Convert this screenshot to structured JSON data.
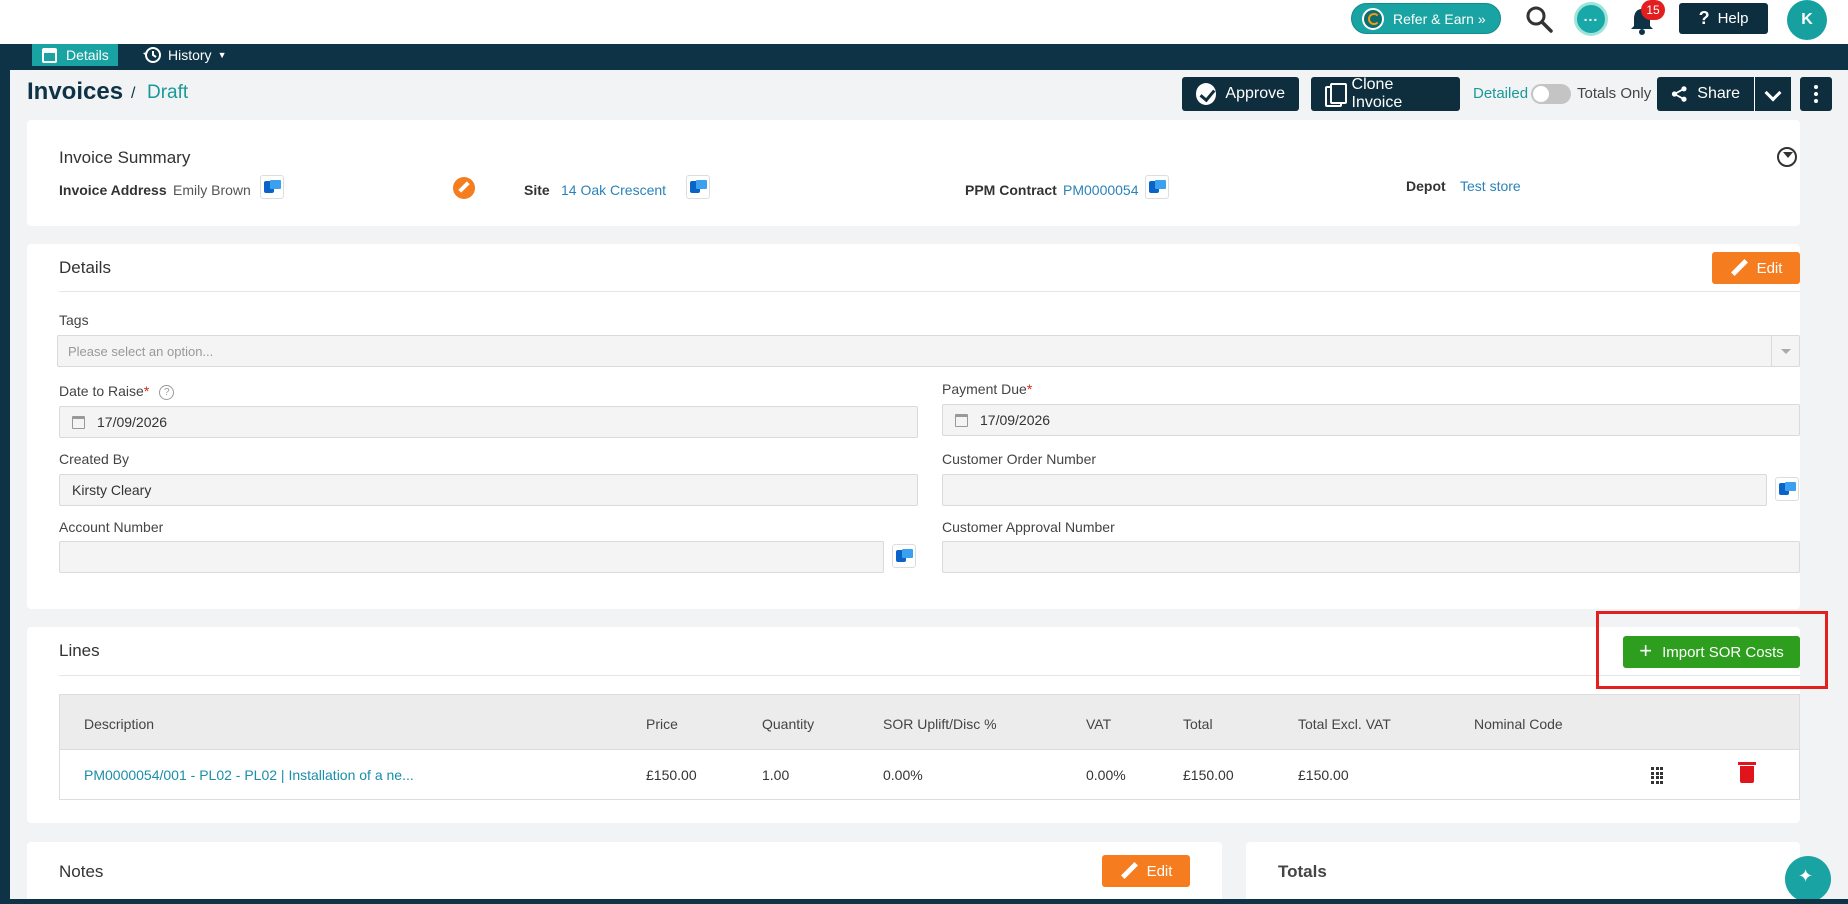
{
  "topbar": {
    "refer_label": "Refer & Earn »",
    "notification_count": "15",
    "help_label": "Help",
    "avatar_initial": "K"
  },
  "tabs": {
    "details": "Details",
    "history": "History"
  },
  "header": {
    "title": "Invoices",
    "separator": "/",
    "status": "Draft",
    "approve_label": "Approve",
    "clone_label": "Clone Invoice",
    "toggle_left": "Detailed",
    "toggle_right": "Totals Only",
    "share_label": "Share"
  },
  "summary": {
    "title": "Invoice Summary",
    "address_label": "Invoice Address",
    "address_value": "Emily Brown",
    "site_label": "Site",
    "site_value": "14 Oak Crescent",
    "ppm_label": "PPM Contract",
    "ppm_value": "PM0000054",
    "depot_label": "Depot",
    "depot_value": "Test store"
  },
  "details": {
    "title": "Details",
    "edit_label": "Edit",
    "tags_label": "Tags",
    "tags_placeholder": "Please select an option...",
    "date_raise_label": "Date to Raise",
    "date_raise_value": "17/09/2026",
    "payment_due_label": "Payment Due",
    "payment_due_value": "17/09/2026",
    "created_by_label": "Created By",
    "created_by_value": "Kirsty Cleary",
    "customer_order_label": "Customer Order Number",
    "account_number_label": "Account Number",
    "customer_approval_label": "Customer Approval Number",
    "required_mark": "*",
    "help_mark": "?"
  },
  "lines": {
    "title": "Lines",
    "import_label": "Import SOR Costs",
    "columns": [
      "Description",
      "Price",
      "Quantity",
      "SOR Uplift/Disc %",
      "VAT",
      "Total",
      "Total Excl. VAT",
      "Nominal Code"
    ],
    "rows": [
      {
        "description": "PM0000054/001 - PL02 - PL02 | Installation of a ne...",
        "price": "£150.00",
        "quantity": "1.00",
        "uplift": "0.00%",
        "vat": "0.00%",
        "total": "£150.00",
        "total_excl": "£150.00",
        "nominal": ""
      }
    ]
  },
  "notes": {
    "title": "Notes",
    "edit_label": "Edit"
  },
  "totals": {
    "title": "Totals"
  },
  "colors": {
    "navy": "#0e2d3d",
    "teal": "#1aa3a3",
    "orange": "#f57c1f",
    "green": "#2e9e1e",
    "red": "#e41f1f"
  }
}
